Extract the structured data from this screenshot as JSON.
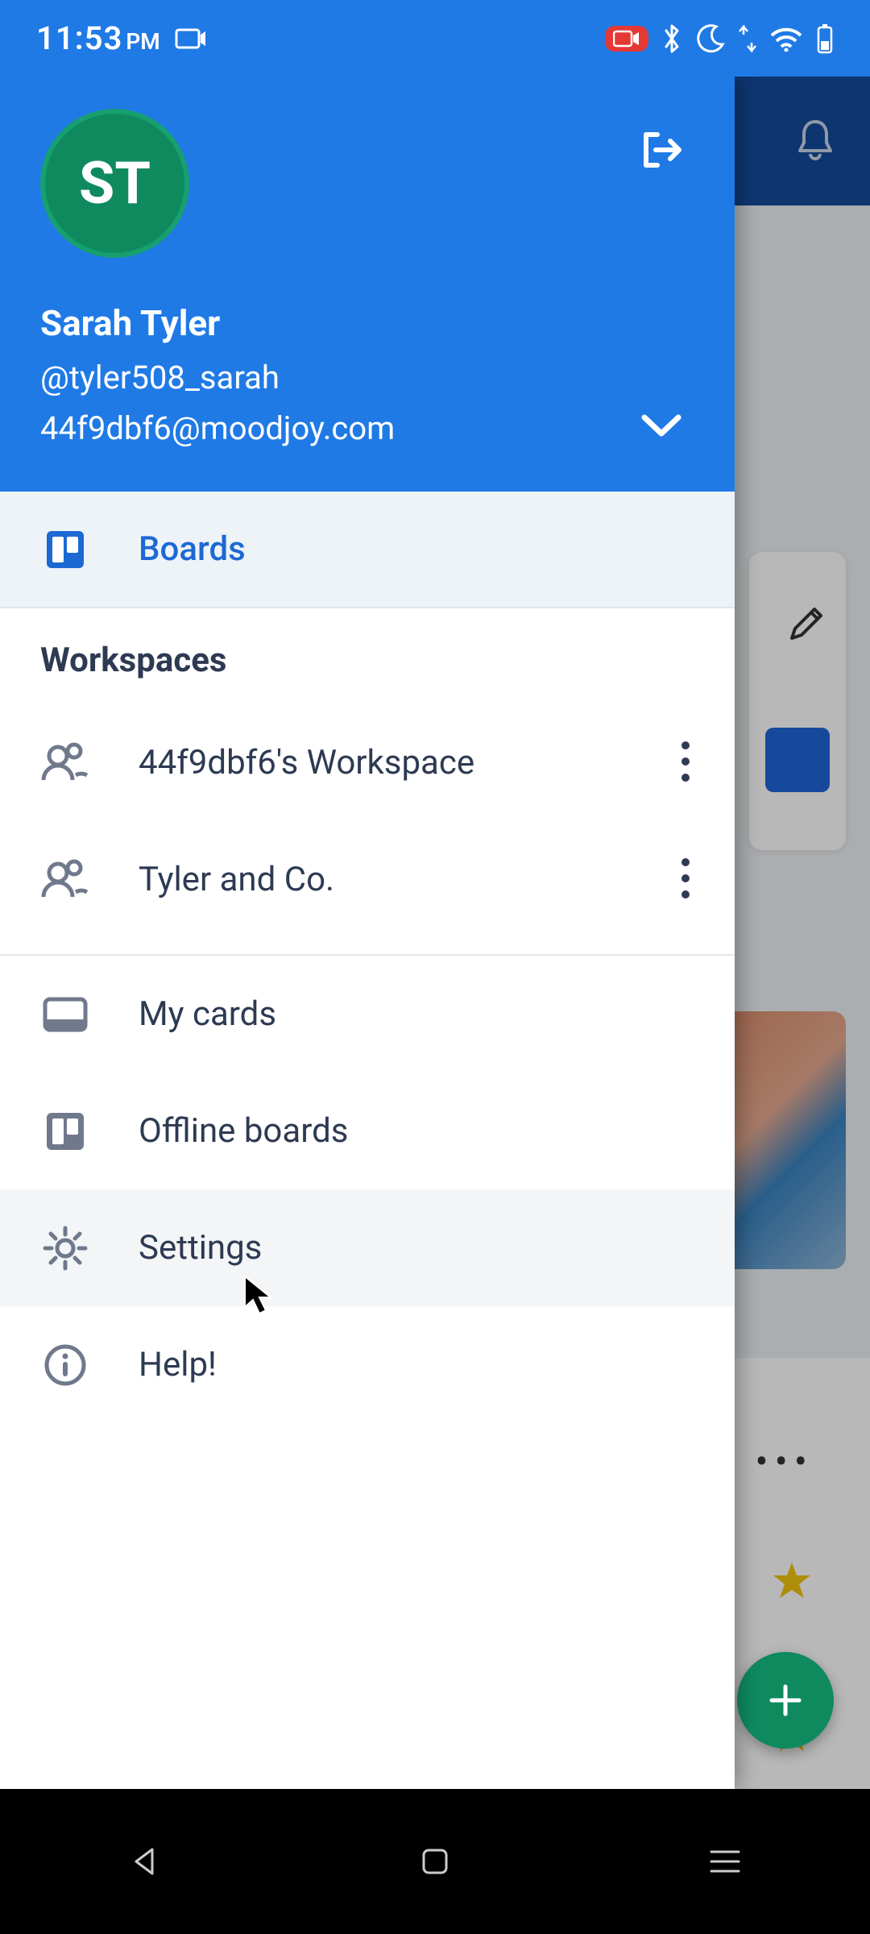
{
  "status": {
    "time": "11:53",
    "ampm": "PM"
  },
  "account": {
    "initials": "ST",
    "name": "Sarah Tyler",
    "handle": "@tyler508_sarah",
    "email": "44f9dbf6@moodjoy.com"
  },
  "drawer": {
    "boards": "Boards",
    "workspaces_label": "Workspaces",
    "workspaces": [
      {
        "name": "44f9dbf6's Workspace"
      },
      {
        "name": "Tyler and Co."
      }
    ],
    "items": {
      "my_cards": "My cards",
      "offline_boards": "Offline boards",
      "settings": "Settings",
      "help": "Help!"
    }
  },
  "background": {
    "more": "•••"
  }
}
